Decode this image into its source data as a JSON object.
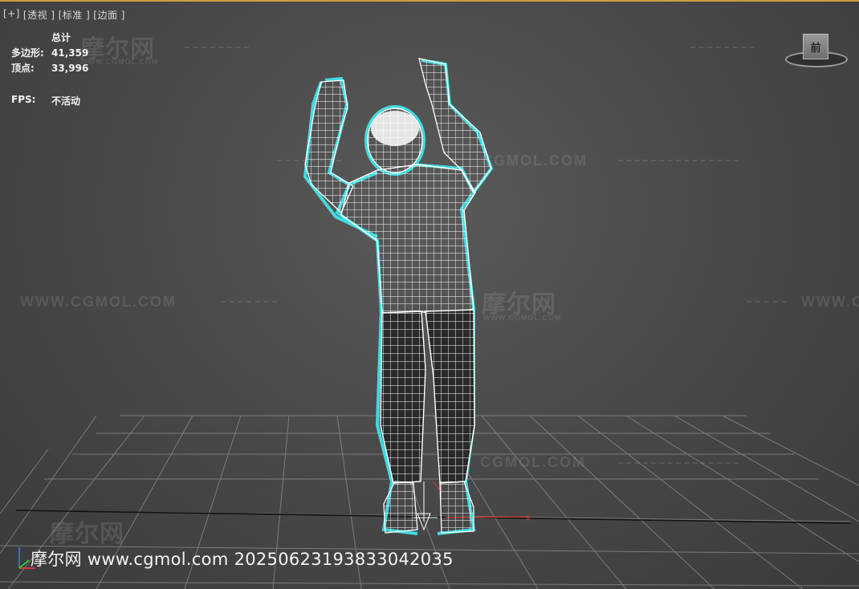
{
  "viewport": {
    "labels": [
      "[+]",
      "[透视 ]",
      "[标准 ]",
      "[边面 ]"
    ],
    "stats": {
      "header": "总计",
      "polygons_label": "多边形:",
      "polygons_value": "41,359",
      "vertices_label": "顶点:",
      "vertices_value": "33,996",
      "fps_label": "FPS:",
      "fps_value": "不活动"
    },
    "viewcube_label": "前"
  },
  "watermarks": {
    "url": "WWW.CGMOL.COM",
    "partial_url": "CGMOL.COM",
    "cn": "摩尔网",
    "small": "WWW.CGMOL.COM"
  },
  "footer_watermark": "摩尔网 www.cgmol.com 20250623193833042035",
  "colors": {
    "background": "#4a4a4a",
    "grid": "#8a8a8a",
    "wire": "#ffffff",
    "selection_outline": "#3fe3e8",
    "accent_top": "#c9a13c"
  }
}
